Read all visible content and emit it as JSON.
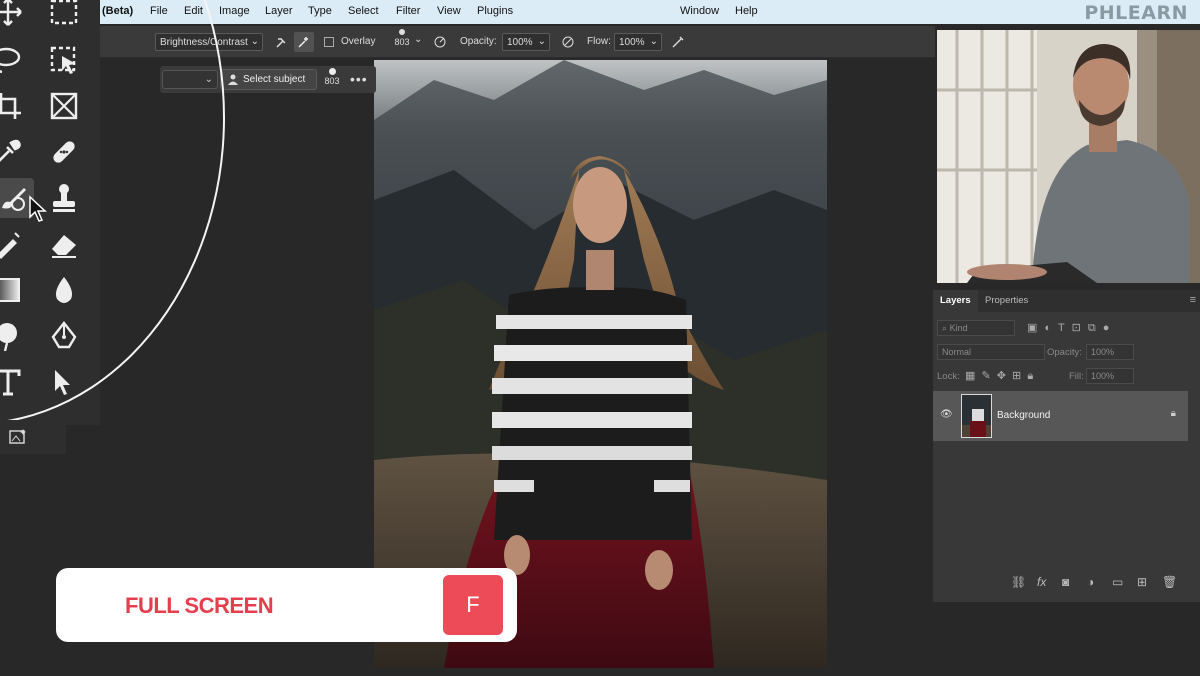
{
  "menubar": {
    "beta_label": "(Beta)",
    "items": [
      "File",
      "Edit",
      "Image",
      "Layer",
      "Type",
      "Select",
      "Filter",
      "View",
      "Plugins"
    ],
    "right_items": [
      "Window",
      "Help"
    ],
    "brand": "PHLEARN",
    "background_color": "#dcecf6"
  },
  "options_bar": {
    "adjustment_value": "Brightness/Contrast",
    "overlay_label": "Overlay",
    "brush_size": "803",
    "opacity_label": "Opacity:",
    "opacity_value": "100%",
    "flow_label": "Flow:",
    "flow_value": "100%"
  },
  "context_bar": {
    "select_subject_label": "Select subject",
    "brush_size": "803",
    "more_icon": "more-horizontal-icon"
  },
  "toolbar": {
    "tools": [
      "move-icon",
      "marquee-icon",
      "lasso-icon",
      "object-selection-icon",
      "crop-icon",
      "frame-icon",
      "eyedropper-icon",
      "healing-brush-icon",
      "brush-icon",
      "clone-stamp-icon",
      "history-brush-icon",
      "eraser-icon",
      "gradient-icon",
      "blur-icon",
      "dodge-icon",
      "pen-icon",
      "type-icon",
      "path-selection-icon",
      "generative-fill-icon"
    ],
    "active_tool": "brush-icon"
  },
  "layers_panel": {
    "tabs": [
      "Layers",
      "Properties"
    ],
    "active_tab": "Layers",
    "filter_label": "Kind",
    "blend_mode": "Normal",
    "opacity_label": "Opacity:",
    "opacity_value": "100%",
    "lock_label": "Lock:",
    "fill_label": "Fill:",
    "fill_value": "100%",
    "layers": [
      {
        "name": "Background",
        "visible": true,
        "locked": true
      }
    ]
  },
  "overlay": {
    "label": "FULL SCREEN",
    "shortcut_key": "F",
    "accent_color": "#ee4b58"
  }
}
